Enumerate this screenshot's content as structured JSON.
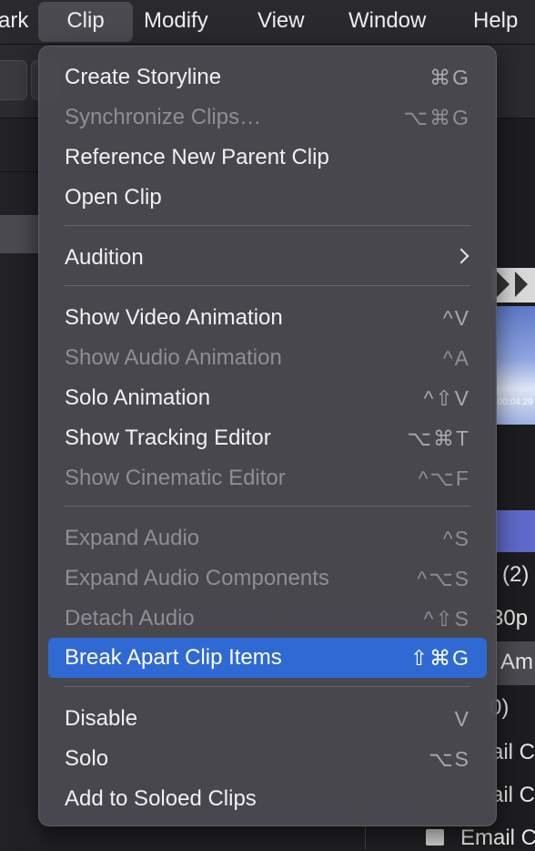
{
  "menubar": {
    "items": [
      "ark",
      "Clip",
      "Modify",
      "View",
      "Window",
      "Help"
    ],
    "active": "Clip"
  },
  "menu": {
    "items": [
      {
        "label": "Create Storyline",
        "shortcut": "⌘G",
        "enabled": true
      },
      {
        "label": "Synchronize Clips…",
        "shortcut": "⌥⌘G",
        "enabled": false
      },
      {
        "label": "Reference New Parent Clip",
        "shortcut": "",
        "enabled": true
      },
      {
        "label": "Open Clip",
        "shortcut": "",
        "enabled": true
      },
      {
        "label": "Audition",
        "shortcut": "",
        "enabled": true,
        "submenu": true
      },
      {
        "label": "Show Video Animation",
        "shortcut": "^V",
        "enabled": true
      },
      {
        "label": "Show Audio Animation",
        "shortcut": "^A",
        "enabled": false
      },
      {
        "label": "Solo Animation",
        "shortcut": "^⇧V",
        "enabled": true
      },
      {
        "label": "Show Tracking Editor",
        "shortcut": "⌥⌘T",
        "enabled": true
      },
      {
        "label": "Show Cinematic Editor",
        "shortcut": "^⌥F",
        "enabled": false
      },
      {
        "label": "Expand Audio",
        "shortcut": "^S",
        "enabled": false
      },
      {
        "label": "Expand Audio Components",
        "shortcut": "^⌥S",
        "enabled": false
      },
      {
        "label": "Detach Audio",
        "shortcut": "^⇧S",
        "enabled": false
      },
      {
        "label": "Break Apart Clip Items",
        "shortcut": "⇧⌘G",
        "enabled": true,
        "selected": true
      },
      {
        "label": "Disable",
        "shortcut": "V",
        "enabled": true
      },
      {
        "label": "Solo",
        "shortcut": "⌥S",
        "enabled": true
      },
      {
        "label": "Add to Soloed Clips",
        "shortcut": "",
        "enabled": true
      }
    ]
  },
  "background": {
    "timecode": ":00:04:29",
    "side_texts": [
      "(2)",
      "30p",
      "Am",
      "0)",
      "ail C",
      "ail C",
      "Email C"
    ]
  },
  "colors": {
    "selection": "#2f69d3",
    "menu_bg": "#48484e",
    "purple_bar": "#5e6ac9"
  }
}
